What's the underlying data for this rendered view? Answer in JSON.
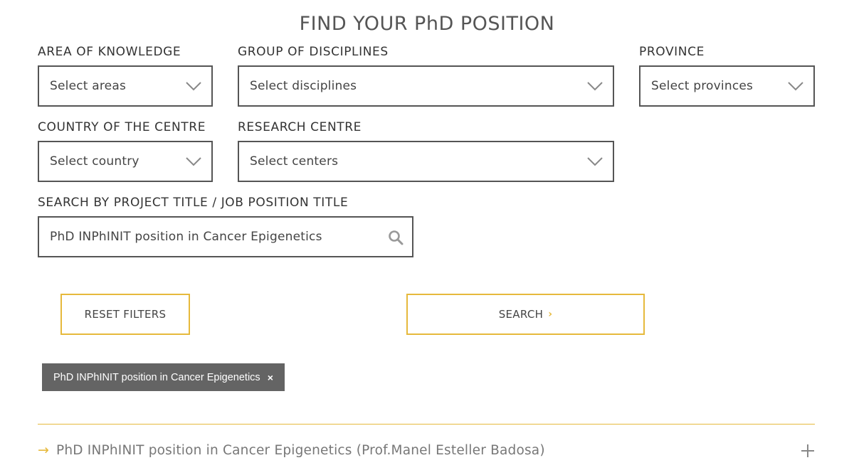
{
  "page": {
    "title": "FIND YOUR PhD POSITION"
  },
  "filters": {
    "area": {
      "label": "AREA OF KNOWLEDGE",
      "placeholder": "Select areas"
    },
    "disciplines": {
      "label": "GROUP OF DISCIPLINES",
      "placeholder": "Select disciplines"
    },
    "province": {
      "label": "PROVINCE",
      "placeholder": "Select provinces"
    },
    "country": {
      "label": "COUNTRY OF THE CENTRE",
      "placeholder": "Select country"
    },
    "centre": {
      "label": "RESEARCH CENTRE",
      "placeholder": "Select centers"
    },
    "search": {
      "label": "SEARCH BY PROJECT TITLE / JOB POSITION TITLE",
      "value": "PhD INPhINIT position in Cancer Epigenetics"
    }
  },
  "buttons": {
    "reset": "RESET FILTERS",
    "search": "SEARCH",
    "search_arrow": "›"
  },
  "active_filter": {
    "text": "PhD INPhINIT position in Cancer Epigenetics",
    "remove": "×"
  },
  "results": [
    {
      "arrow": "→",
      "title": "PhD INPhINIT position in Cancer Epigenetics (Prof.Manel Esteller Badosa)",
      "expand": "+"
    }
  ],
  "colors": {
    "accent": "#e6b93c",
    "border": "#555555",
    "chip_bg": "#646464"
  },
  "icons": {
    "dropdown": "chevron-down-icon",
    "search": "search-icon",
    "expand": "plus-icon"
  }
}
